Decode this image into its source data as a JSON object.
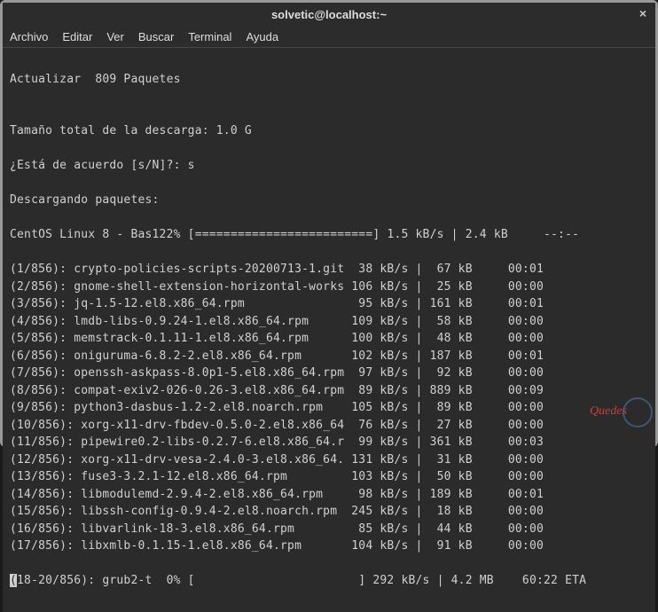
{
  "window": {
    "title": "solvetic@localhost:~",
    "close_glyph": "×"
  },
  "menu": {
    "archivo": "Archivo",
    "editar": "Editar",
    "ver": "Ver",
    "buscar": "Buscar",
    "terminal": "Terminal",
    "ayuda": "Ayuda"
  },
  "body": {
    "update": "Actualizar  809 Paquetes",
    "blank": "",
    "size": "Tamaño total de la descarga: 1.0 G",
    "confirm": "¿Está de acuerdo [s/N]?: s",
    "downloading": "Descargando paquetes:",
    "repo": "CentOS Linux 8 - Bas122% [=========================] 1.5 kB/s | 2.4 kB     --:--",
    "rows": [
      "(1/856): crypto-policies-scripts-20200713-1.git  38 kB/s |  67 kB     00:01",
      "(2/856): gnome-shell-extension-horizontal-works 106 kB/s |  25 kB     00:00",
      "(3/856): jq-1.5-12.el8.x86_64.rpm                95 kB/s | 161 kB     00:01",
      "(4/856): lmdb-libs-0.9.24-1.el8.x86_64.rpm      109 kB/s |  58 kB     00:00",
      "(5/856): memstrack-0.1.11-1.el8.x86_64.rpm      100 kB/s |  48 kB     00:00",
      "(6/856): oniguruma-6.8.2-2.el8.x86_64.rpm       102 kB/s | 187 kB     00:01",
      "(7/856): openssh-askpass-8.0p1-5.el8.x86_64.rpm  97 kB/s |  92 kB     00:00",
      "(8/856): compat-exiv2-026-0.26-3.el8.x86_64.rpm  89 kB/s | 889 kB     00:09",
      "(9/856): python3-dasbus-1.2-2.el8.noarch.rpm    105 kB/s |  89 kB     00:00",
      "(10/856): xorg-x11-drv-fbdev-0.5.0-2.el8.x86_64  76 kB/s |  27 kB     00:00",
      "(11/856): pipewire0.2-libs-0.2.7-6.el8.x86_64.r  99 kB/s | 361 kB     00:03",
      "(12/856): xorg-x11-drv-vesa-2.4.0-3.el8.x86_64. 131 kB/s |  31 kB     00:00",
      "(13/856): fuse3-3.2.1-12.el8.x86_64.rpm         103 kB/s |  50 kB     00:00",
      "(14/856): libmodulemd-2.9.4-2.el8.x86_64.rpm     98 kB/s | 189 kB     00:01",
      "(15/856): libssh-config-0.9.4-2.el8.noarch.rpm  245 kB/s |  18 kB     00:00",
      "(16/856): libvarlink-18-3.el8.x86_64.rpm         85 kB/s |  44 kB     00:00",
      "(17/856): libxmlb-0.1.15-1.el8.x86_64.rpm       104 kB/s |  91 kB     00:00"
    ],
    "progress_prefix": "(",
    "progress_rest": "18-20/856): grub2-t  0% [                       ] 292 kB/s | 4.2 MB    60:22 ETA"
  },
  "watermark": "Quedes"
}
